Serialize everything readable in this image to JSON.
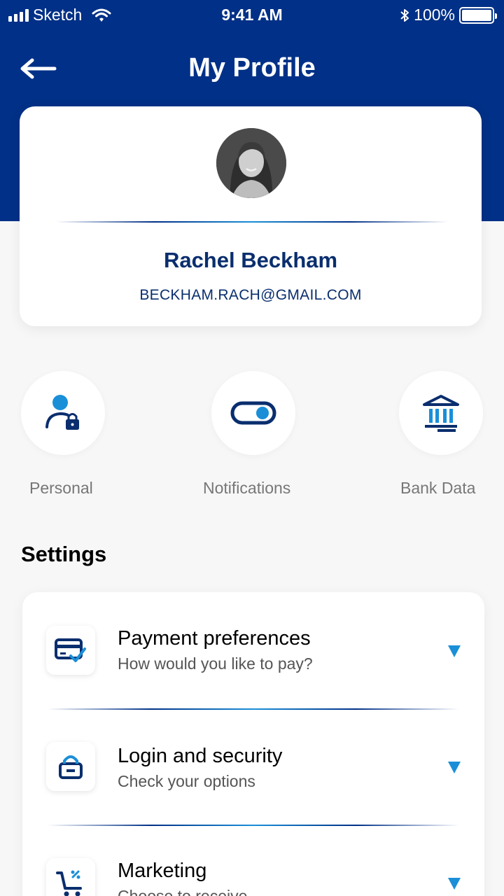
{
  "status_bar": {
    "carrier": "Sketch",
    "time": "9:41 AM",
    "battery": "100%"
  },
  "header": {
    "title": "My Profile",
    "back_icon": "arrow-left-icon"
  },
  "profile": {
    "name": "Rachel Beckham",
    "email": "BECKHAM.RACH@GMAIL.COM"
  },
  "quick_actions": [
    {
      "label": "Personal",
      "icon": "user-lock-icon"
    },
    {
      "label": "Notifications",
      "icon": "toggle-icon"
    },
    {
      "label": "Bank Data",
      "icon": "bank-icon"
    }
  ],
  "settings": {
    "title": "Settings",
    "items": [
      {
        "title": "Payment preferences",
        "subtitle": "How would you like to pay?",
        "icon": "card-check-icon"
      },
      {
        "title": "Login and security",
        "subtitle": "Check your options",
        "icon": "lock-icon"
      },
      {
        "title": "Marketing",
        "subtitle": "Choose to receive",
        "icon": "cart-icon"
      }
    ]
  },
  "colors": {
    "primary": "#003087",
    "accent": "#1a8fd8",
    "background": "#f7f7f7"
  }
}
